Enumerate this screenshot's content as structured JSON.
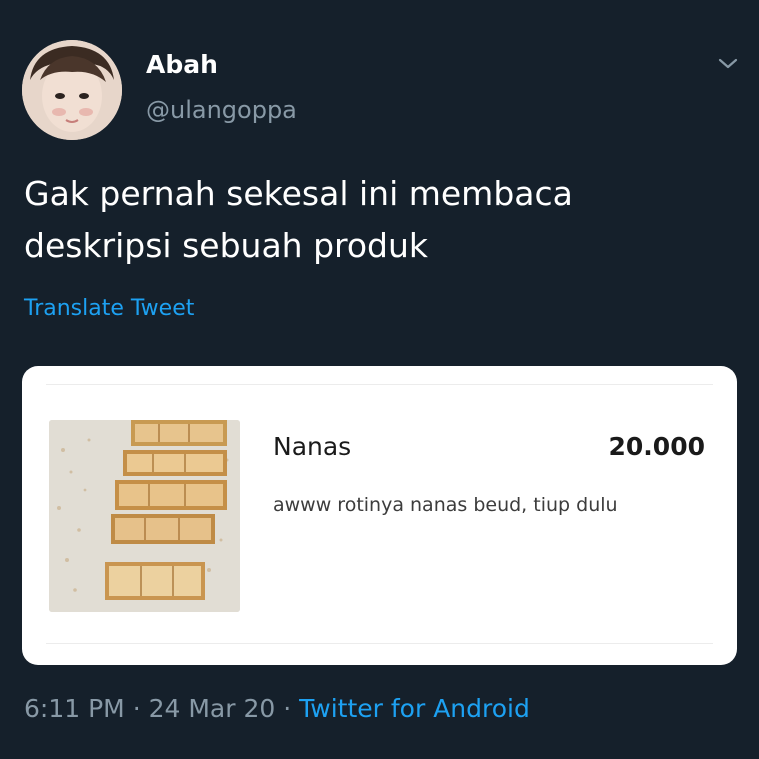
{
  "tweet": {
    "author": {
      "name": "Abah",
      "handle": "@ulangoppa",
      "avatar_icon": "profile-photo"
    },
    "menu_icon": "chevron-down-icon",
    "text_lines": [
      "Gak pernah sekesal ini membaca",
      "deskripsi sebuah produk"
    ],
    "translate_label": "Translate Tweet",
    "time": "6:11 PM",
    "separator": "·",
    "date": "24 Mar 20",
    "source": "Twitter for Android"
  },
  "product": {
    "name": "Nanas",
    "price": "20.000",
    "description": "awww rotinya nanas beud, tiup dulu",
    "image_icon": "pineapple-pastry-photo"
  },
  "colors": {
    "background": "#15202b",
    "accent": "#1da1f2",
    "secondary_text": "#8899a6",
    "card": "#ffffff"
  }
}
